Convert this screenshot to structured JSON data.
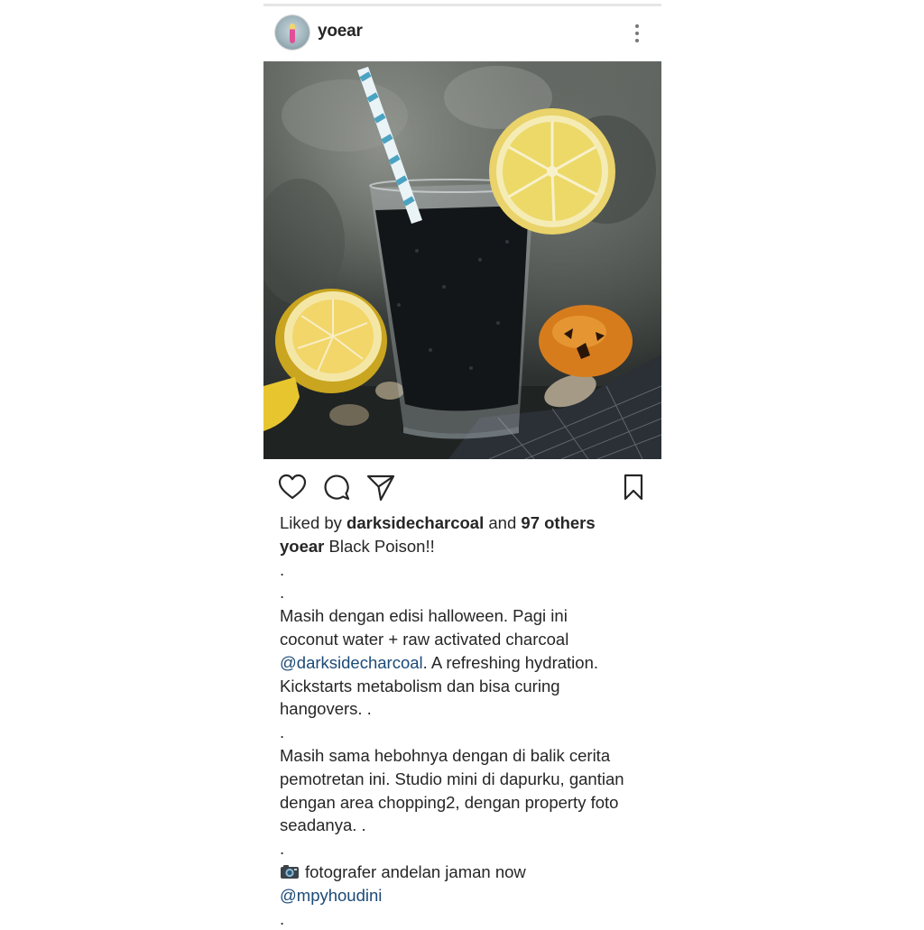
{
  "post": {
    "username": "yoear",
    "liked_by_prefix": "Liked by",
    "liked_by_user": "darksidecharcoal",
    "liked_by_and": "and",
    "liked_by_others": "97 others",
    "caption_user": "yoear",
    "caption_title": "Black Poison!!",
    "caption": {
      "dot1": ".",
      "dot2": ".",
      "p1_l1": "Masih dengan edisi halloween. Pagi ini",
      "p1_l2": "coconut water + raw activated charcoal",
      "p1_mention": "@darksidecharcoal",
      "p1_l3_rest": ". A refreshing hydration.",
      "p1_l4": "Kickstarts metabolism dan bisa curing",
      "p1_l5": "hangovers. .",
      "dot3": ".",
      "p2_l1": "Masih sama hebohnya dengan di balik cerita",
      "p2_l2": "pemotretan ini. Studio mini di dapurku, gantian",
      "p2_l3": "dengan area chopping2, dengan property foto",
      "p2_l4": "seadanya. .",
      "dot4": ".",
      "credit_text": "fotografer andelan jaman now",
      "credit_mention": "@mpyhoudini",
      "dot5": "."
    }
  },
  "icons": {
    "more": "more-vertical-icon",
    "like": "heart-icon",
    "comment": "comment-icon",
    "share": "paper-plane-icon",
    "save": "bookmark-icon",
    "camera": "camera-emoji-icon"
  },
  "colors": {
    "text": "#262626",
    "mention": "#1c4a78",
    "divider": "#e6e6e6"
  }
}
